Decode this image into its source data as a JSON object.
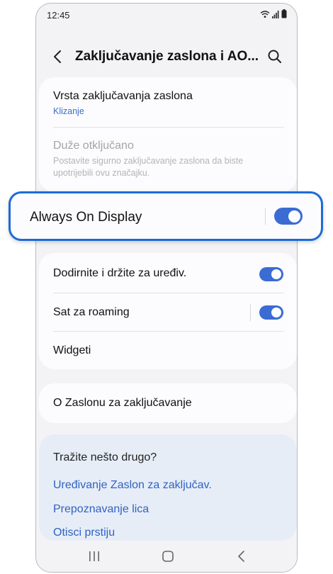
{
  "status": {
    "time": "12:45"
  },
  "header": {
    "title": "Zaključavanje zaslona i AO..."
  },
  "lock_card": {
    "lock_type_title": "Vrsta zaključavanja zaslona",
    "lock_type_value": "Klizanje",
    "extend_unlock_title": "Duže otključano",
    "extend_unlock_desc": "Postavite sigurno zaključavanje zaslona da biste upotrijebili ovu značajku."
  },
  "aod": {
    "label": "Always On Display",
    "enabled": true
  },
  "settings": {
    "tap_hold_label": "Dodirnite i držite za uređiv.",
    "tap_hold_enabled": true,
    "roaming_clock_label": "Sat za roaming",
    "roaming_clock_enabled": true,
    "widgets_label": "Widgeti"
  },
  "about": {
    "label": "O Zaslonu za zaključavanje"
  },
  "suggestions": {
    "title": "Tražite nešto drugo?",
    "links": [
      "Uređivanje Zaslon za zaključav.",
      "Prepoznavanje lica",
      "Otisci prstiju"
    ]
  },
  "colors": {
    "accent": "#3b6cd4",
    "highlight_border": "#1c6bd8",
    "link": "#2f63c2"
  },
  "icons": [
    "wifi-icon",
    "signal-icon",
    "battery-icon",
    "back-arrow-icon",
    "search-icon",
    "recents-icon",
    "home-icon",
    "nav-back-icon"
  ]
}
